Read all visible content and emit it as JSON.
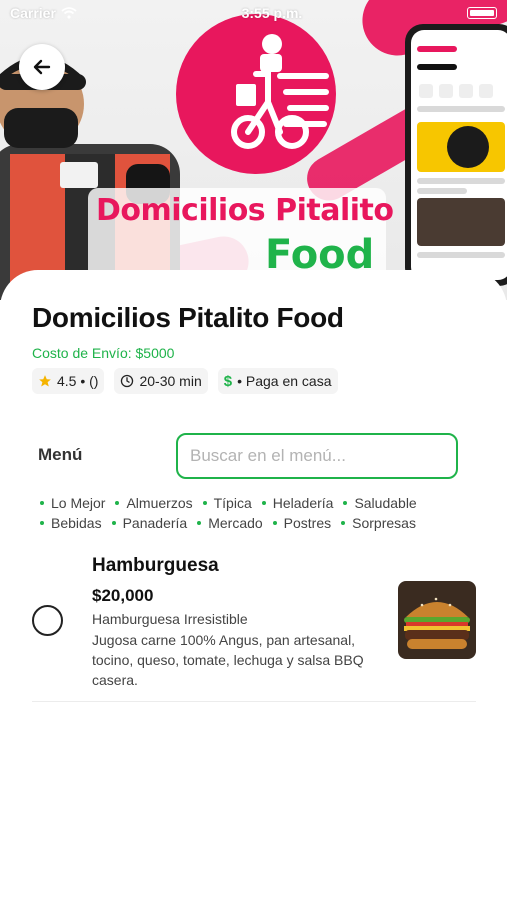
{
  "status_bar": {
    "carrier": "Carrier",
    "time": "3:55 p.m."
  },
  "hero": {
    "brand_line1": "Domicilios Pitalito",
    "brand_line2": "Food",
    "pink": "#e8175d",
    "green": "#1fb34a"
  },
  "store": {
    "title": "Domicilios Pitalito Food",
    "shipping": "Costo de Envío: $5000",
    "rating": "4.5 • ()",
    "time": "20-30 min",
    "payment_symbol": "$",
    "payment": "• Paga en casa"
  },
  "menu": {
    "label": "Menú",
    "search_placeholder": "Buscar en el menú...",
    "categories_row1": [
      "Lo Mejor",
      "Almuerzos",
      "Típica",
      "Heladería",
      "Saludable"
    ],
    "categories_row2": [
      "Bebidas",
      "Panadería",
      "Mercado",
      "Postres",
      "Sorpresas"
    ]
  },
  "items": [
    {
      "name": "Hamburguesa",
      "price": "$20,000",
      "subtitle": "Hamburguesa Irresistible",
      "description": "Jugosa carne 100% Angus, pan artesanal, tocino, queso, tomate, lechuga y salsa BBQ casera."
    }
  ],
  "icons": {
    "back": "arrow-left-icon",
    "wifi": "wifi-icon",
    "star": "star-icon",
    "clock": "clock-icon",
    "battery": "battery-icon"
  }
}
